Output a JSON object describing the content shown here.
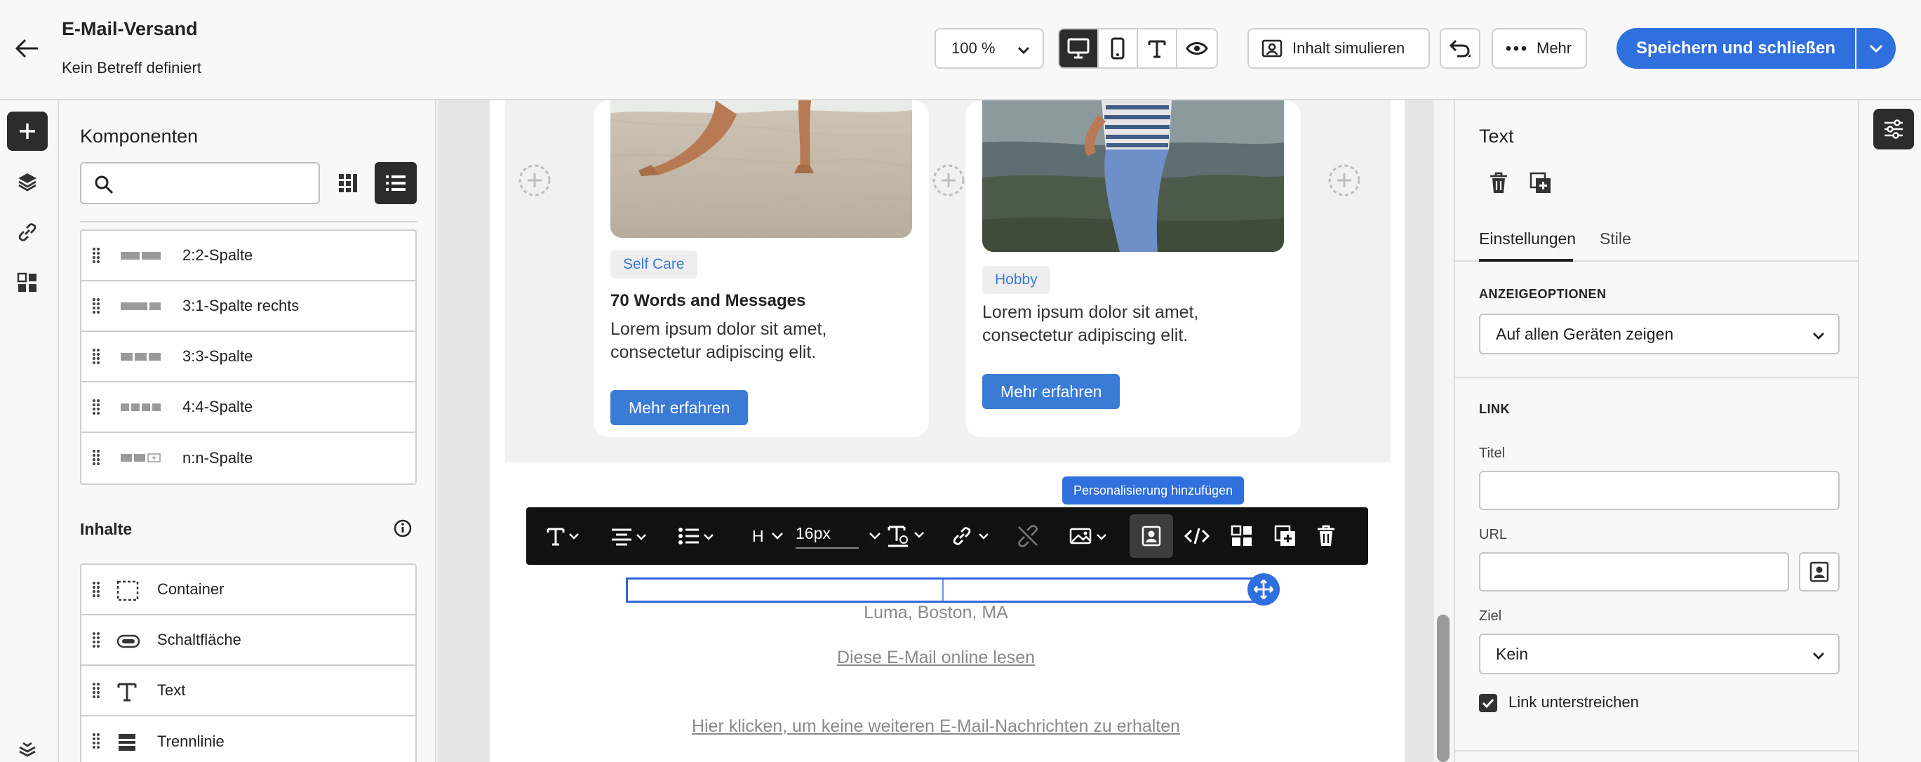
{
  "header": {
    "title": "E-Mail-Versand",
    "subtitle": "Kein Betreff definiert",
    "zoom": "100 %",
    "simulate_label": "Inhalt simulieren",
    "more_label": "Mehr",
    "save_label": "Speichern und schließen"
  },
  "components_panel": {
    "title": "Komponenten",
    "search_placeholder": "",
    "structures": [
      {
        "label": "2:2-Spalte"
      },
      {
        "label": "3:1-Spalte rechts"
      },
      {
        "label": "3:3-Spalte"
      },
      {
        "label": "4:4-Spalte"
      },
      {
        "label": "n:n-Spalte"
      }
    ],
    "contents_heading": "Inhalte",
    "contents": [
      {
        "label": "Container"
      },
      {
        "label": "Schaltfläche"
      },
      {
        "label": "Text"
      },
      {
        "label": "Trennlinie"
      }
    ]
  },
  "email": {
    "card1": {
      "tag": "Self Care",
      "title": "70 Words and Messages",
      "text": "Lorem ipsum dolor sit amet, consectetur adipiscing elit.",
      "button": "Mehr erfahren"
    },
    "card2": {
      "tag": "Hobby",
      "text": "Lorem ipsum dolor sit amet, consectetur adipiscing elit.",
      "button": "Mehr erfahren"
    },
    "toolbar": {
      "font_size": "16px",
      "heading": "H",
      "tooltip": "Personalisierung hinzufügen"
    },
    "footer": {
      "location": "Luma, Boston, MA",
      "online_link": "Diese E-Mail online lesen",
      "unsubscribe_link": "Hier klicken, um keine weiteren E-Mail-Nachrichten zu erhalten"
    }
  },
  "properties": {
    "title": "Text",
    "tabs": [
      "Einstellungen",
      "Stile"
    ],
    "display_options_label": "ANZEIGEOPTIONEN",
    "display_value": "Auf allen Geräten zeigen",
    "link_label": "LINK",
    "title_field_label": "Titel",
    "title_value": "",
    "url_label": "URL",
    "url_value": "",
    "target_label": "Ziel",
    "target_value": "Kein",
    "underline_label": "Link unterstreichen",
    "underline_checked": true
  },
  "colors": {
    "primary": "#2f6fde",
    "card_button": "#3a7bd5",
    "toolbar": "#111111"
  }
}
